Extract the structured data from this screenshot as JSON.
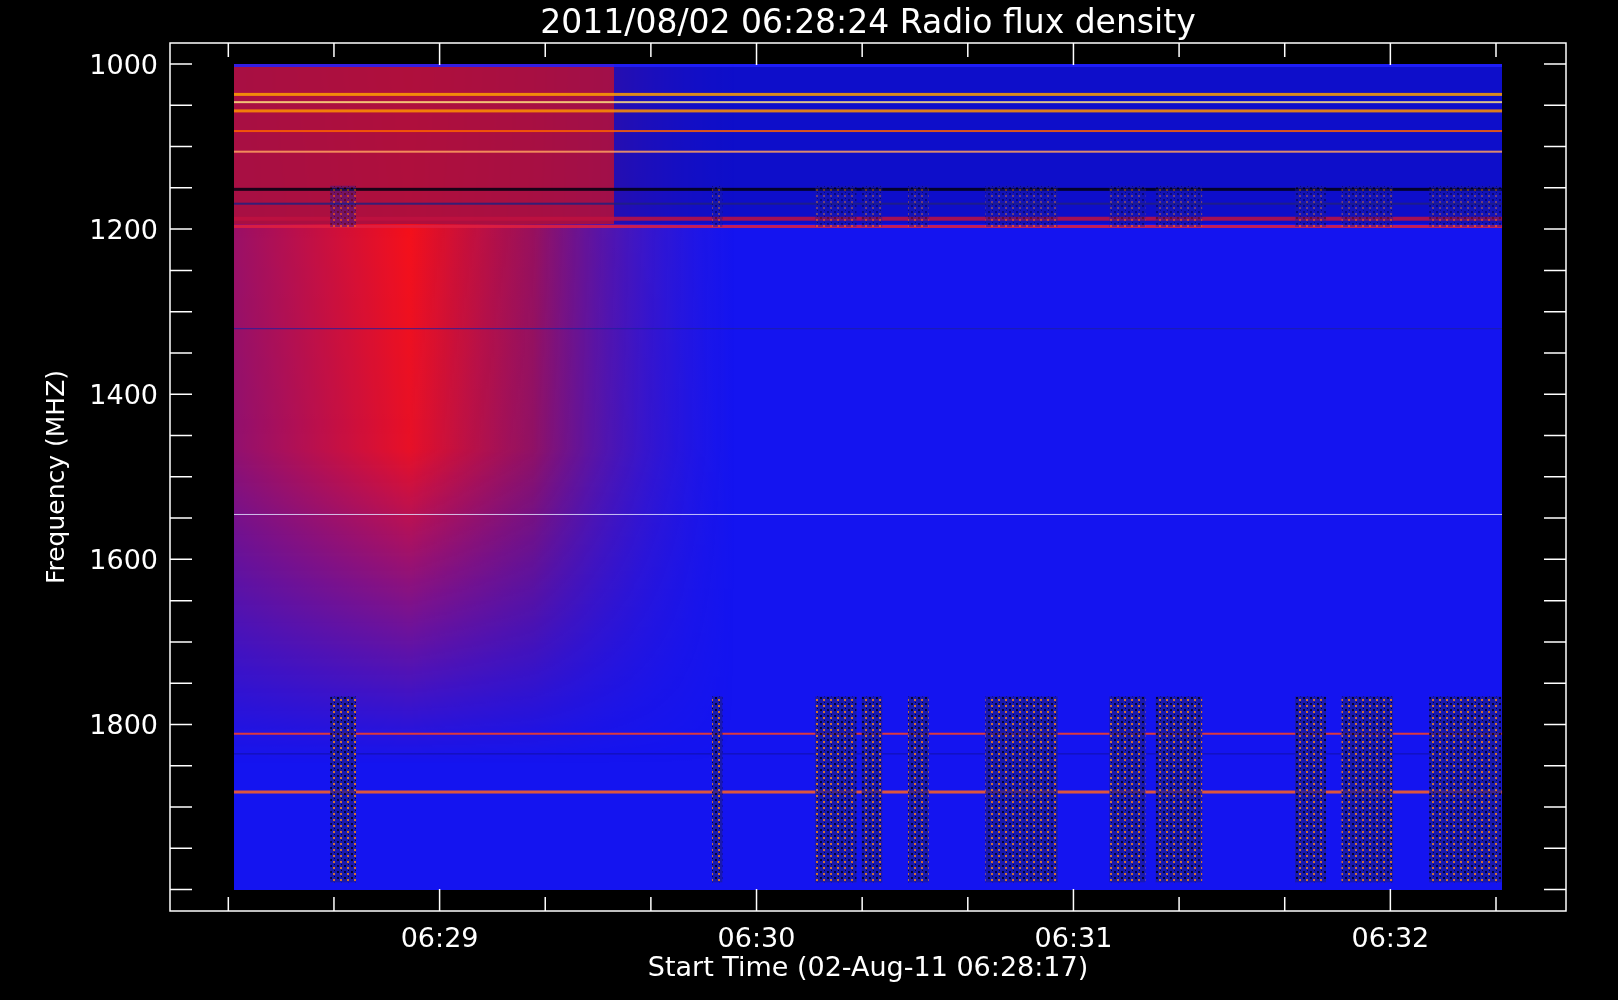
{
  "title": "2011/08/02 06:28:24 Radio flux density",
  "xlabel": "Start Time (02-Aug-11 06:28:17)",
  "ylabel": "Frequency (MHZ)",
  "x_tick_labels": [
    "06:29",
    "06:30",
    "06:31",
    "06:32"
  ],
  "y_tick_labels": [
    "1000",
    "1200",
    "1400",
    "1600",
    "1800"
  ]
}
